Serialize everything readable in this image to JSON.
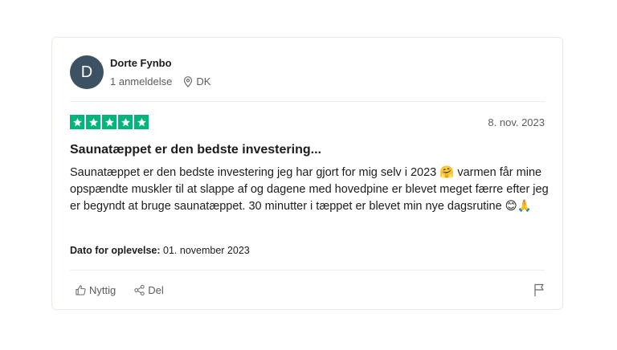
{
  "reviewer": {
    "initial": "D",
    "name": "Dorte Fynbo",
    "review_count": "1 anmeldelse",
    "country": "DK",
    "avatar_color": "#3c5162"
  },
  "review": {
    "rating": 5,
    "star_color": "#00b67a",
    "date": "8. nov. 2023",
    "title": "Saunatæppet er den bedste investering...",
    "body": "Saunatæppet er den bedste investering jeg har gjort for mig selv i 2023 🤗 varmen får mine opspændte muskler til at slappe af og dagene med hovedpine er blevet meget færre efter jeg er begyndt at bruge saunatæppet. 30 minutter i tæppet er blevet min nye dagsrutine 😊🙏",
    "experience_label": "Dato for oplevelse:",
    "experience_date": "01. november 2023"
  },
  "actions": {
    "useful": "Nyttig",
    "share": "Del",
    "useful_icon": "thumbs-up-icon",
    "share_icon": "share-icon",
    "flag_icon": "flag-icon"
  }
}
